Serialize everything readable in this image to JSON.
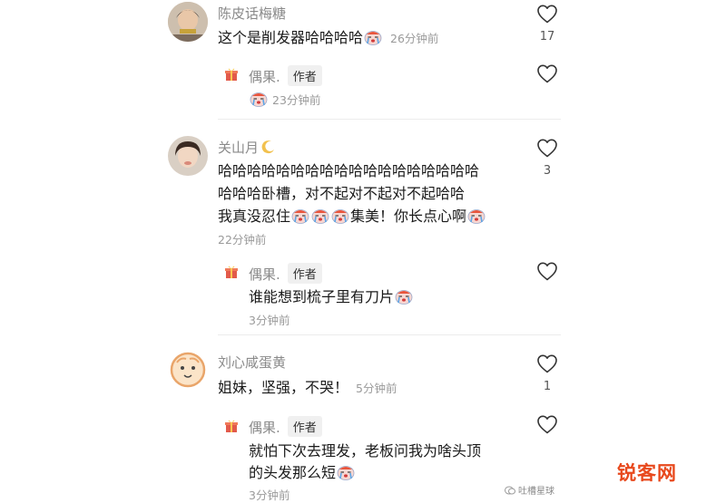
{
  "comments": [
    {
      "username": "陈皮话梅糖",
      "text": "这个是削发器哈哈哈哈",
      "time": "26分钟前",
      "likes": "17",
      "reply": {
        "username": "偶果.",
        "badge": "作者",
        "time": "23分钟前"
      }
    },
    {
      "username": "关山月",
      "lines": [
        "哈哈哈哈哈哈哈哈哈哈哈哈哈哈哈哈哈哈",
        "哈哈哈卧槽，对不起对不起对不起哈哈",
        "我真没忍住",
        "集美！你长点心啊"
      ],
      "time": "22分钟前",
      "likes": "3",
      "reply": {
        "username": "偶果.",
        "badge": "作者",
        "text": "谁能想到梳子里有刀片",
        "time": "3分钟前"
      }
    },
    {
      "username": "刘心咸蛋黄",
      "text": "姐妹，坚强，不哭！",
      "time": "5分钟前",
      "likes": "1",
      "reply": {
        "username": "偶果.",
        "badge": "作者",
        "line1": "就怕下次去理发，老板问我为啥头顶",
        "line2": "的头发那么短",
        "time": "3分钟前"
      }
    }
  ],
  "watermark": {
    "source": "吐槽星球",
    "logo": "锐客网"
  },
  "colors": {
    "username": "#8a8a8a",
    "time": "#9a9a9a",
    "badge_bg": "#f0f0f0",
    "logo": "#e8491d"
  }
}
